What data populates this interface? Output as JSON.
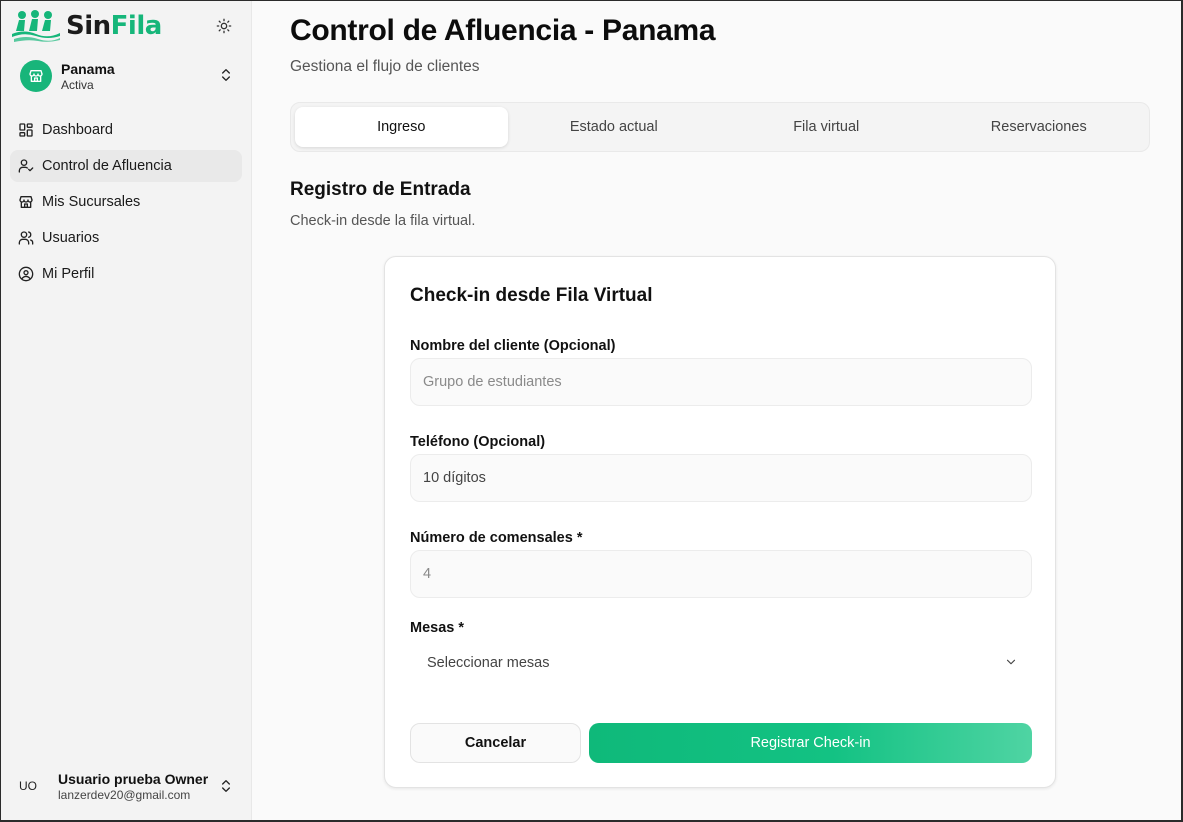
{
  "brand": {
    "name_part1": "Sin",
    "name_part2": "Fila",
    "accent_color": "#16b67a"
  },
  "sidebar": {
    "theme_toggle_icon": "sun-icon",
    "branch": {
      "name": "Panama",
      "status": "Activa"
    },
    "items": [
      {
        "label": "Dashboard",
        "icon": "dashboard-icon",
        "active": false
      },
      {
        "label": "Control de Afluencia",
        "icon": "user-check-icon",
        "active": true
      },
      {
        "label": "Mis Sucursales",
        "icon": "store-icon",
        "active": false
      },
      {
        "label": "Usuarios",
        "icon": "users-icon",
        "active": false
      },
      {
        "label": "Mi Perfil",
        "icon": "user-circle-icon",
        "active": false
      }
    ],
    "user": {
      "initials": "UO",
      "name": "Usuario prueba Owner",
      "email": "lanzerdev20@gmail.com"
    }
  },
  "header": {
    "title": "Control de Afluencia - Panama",
    "subtitle": "Gestiona el flujo de clientes"
  },
  "tabs": [
    {
      "label": "Ingreso",
      "active": true
    },
    {
      "label": "Estado actual",
      "active": false
    },
    {
      "label": "Fila virtual",
      "active": false
    },
    {
      "label": "Reservaciones",
      "active": false
    }
  ],
  "section": {
    "title": "Registro de Entrada",
    "description": "Check-in desde la fila virtual."
  },
  "form": {
    "title": "Check-in desde Fila Virtual",
    "name_label": "Nombre del cliente (Opcional)",
    "name_placeholder": "Grupo de estudiantes",
    "phone_label": "Teléfono (Opcional)",
    "phone_value": "10 dígitos",
    "guests_label": "Número de comensales *",
    "guests_placeholder": "4",
    "tables_label": "Mesas *",
    "tables_placeholder": "Seleccionar mesas",
    "cancel_label": "Cancelar",
    "submit_label": "Registrar Check-in"
  }
}
